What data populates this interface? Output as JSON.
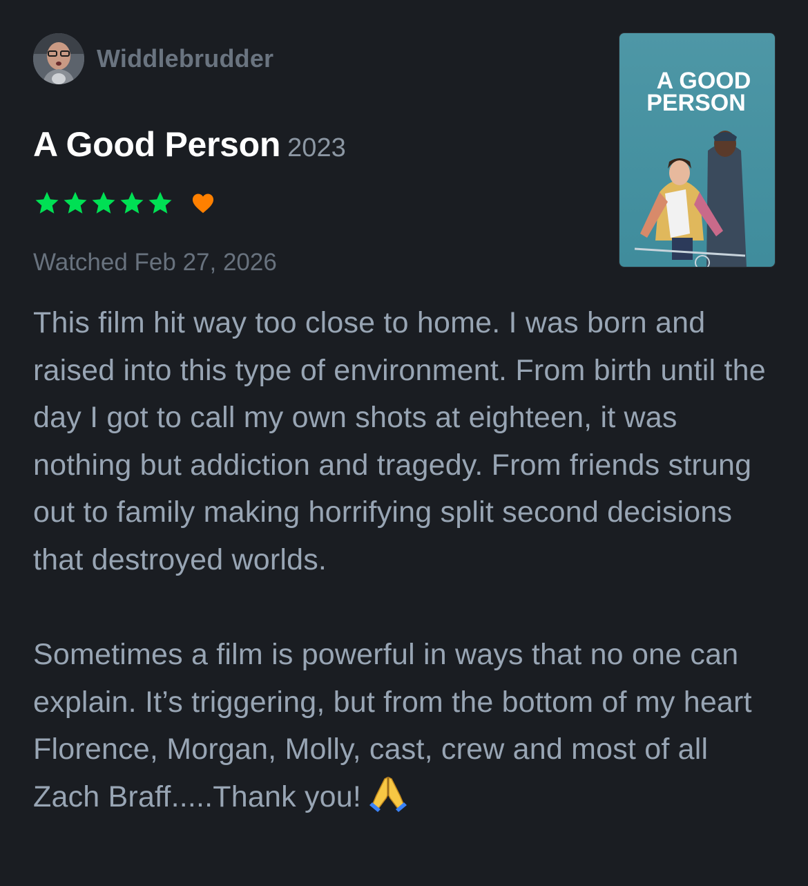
{
  "reviewer": {
    "name": "Widdlebrudder"
  },
  "film": {
    "title": "A Good Person",
    "year": "2023",
    "poster_title": "A GOOD PERSON",
    "poster_line1": "A GOOD",
    "poster_line2": "PERSON"
  },
  "rating": {
    "stars": 5,
    "liked": true,
    "star_color": "#00e054",
    "heart_color": "#ff8000"
  },
  "watched_label": "Watched Feb 27, 2026",
  "review": {
    "paragraph1": "This film hit way too close to home. I was born and raised into this type of environment. From birth until the day I got to call my own shots at eighteen, it was nothing but addiction and tragedy. From friends strung out to family making horrifying split second decisions that destroyed worlds.",
    "paragraph2": "Sometimes a film is powerful in ways that no one can explain. It’s triggering, but from the bottom of my heart Florence, Morgan, Molly, cast, crew and most of all Zach Braff.....Thank you!",
    "emoji": "folded-hands-icon"
  },
  "colors": {
    "background": "#1a1d22",
    "title": "#ffffff",
    "body_text": "#98a5b4",
    "muted_text": "#68727e"
  }
}
